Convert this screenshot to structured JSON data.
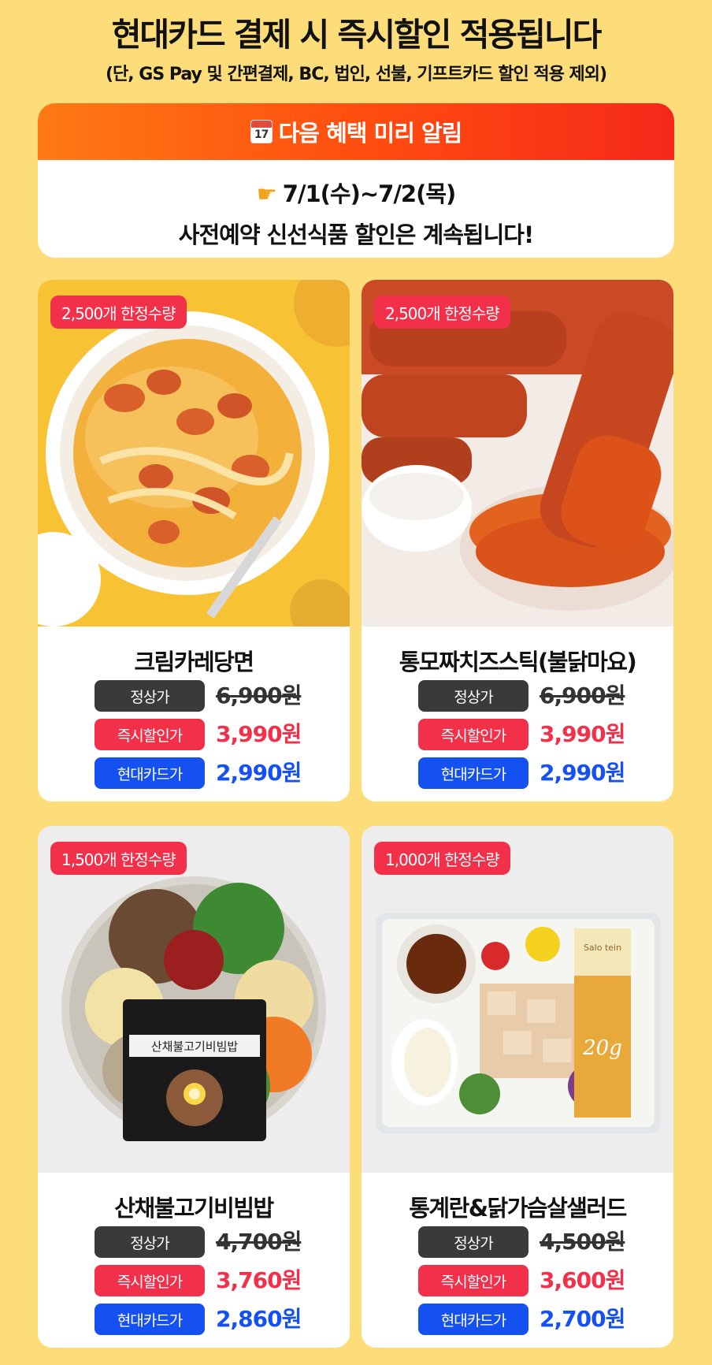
{
  "header": {
    "headline": "현대카드 결제 시 즉시할인 적용됩니다",
    "subline": "(단, GS Pay 및 간편결제, BC, 법인, 선불, 기프트카드 할인 적용 제외)"
  },
  "notice": {
    "calendar_icon_text": "17",
    "title": "다음 혜택 미리 알림",
    "date_icon": "pointing-hand-icon",
    "date": "7/1(수)~7/2(목)",
    "message": "사전예약 신선식품 할인은 계속됩니다!"
  },
  "products": [
    {
      "badge": "2,500개 한정수량",
      "name": "크림카레당면",
      "regular_label": "정상가",
      "regular_price": "6,900원",
      "sale_label": "즉시할인가",
      "sale_price": "3,990원",
      "card_label": "현대카드가",
      "card_price": "2,990원"
    },
    {
      "badge": "2,500개 한정수량",
      "name": "통모짜치즈스틱(불닭마요)",
      "regular_label": "정상가",
      "regular_price": "6,900원",
      "sale_label": "즉시할인가",
      "sale_price": "3,990원",
      "card_label": "현대카드가",
      "card_price": "2,990원"
    },
    {
      "badge": "1,500개 한정수량",
      "name": "산채불고기비빔밥",
      "regular_label": "정상가",
      "regular_price": "4,700원",
      "sale_label": "즉시할인가",
      "sale_price": "3,760원",
      "card_label": "현대카드가",
      "card_price": "2,860원",
      "package_text": "산채불고기비빔밥"
    },
    {
      "badge": "1,000개 한정수량",
      "name": "통계란&닭가슴살샐러드",
      "regular_label": "정상가",
      "regular_price": "4,500원",
      "sale_label": "즉시할인가",
      "sale_price": "3,600원",
      "card_label": "현대카드가",
      "card_price": "2,700원",
      "package_brand": "Salo tein",
      "package_grams": "20g"
    }
  ],
  "colors": {
    "background": "#FDDD7A",
    "accent_red": "#F2304A",
    "card_blue": "#1550F0",
    "label_dark": "#3A3A3A"
  }
}
